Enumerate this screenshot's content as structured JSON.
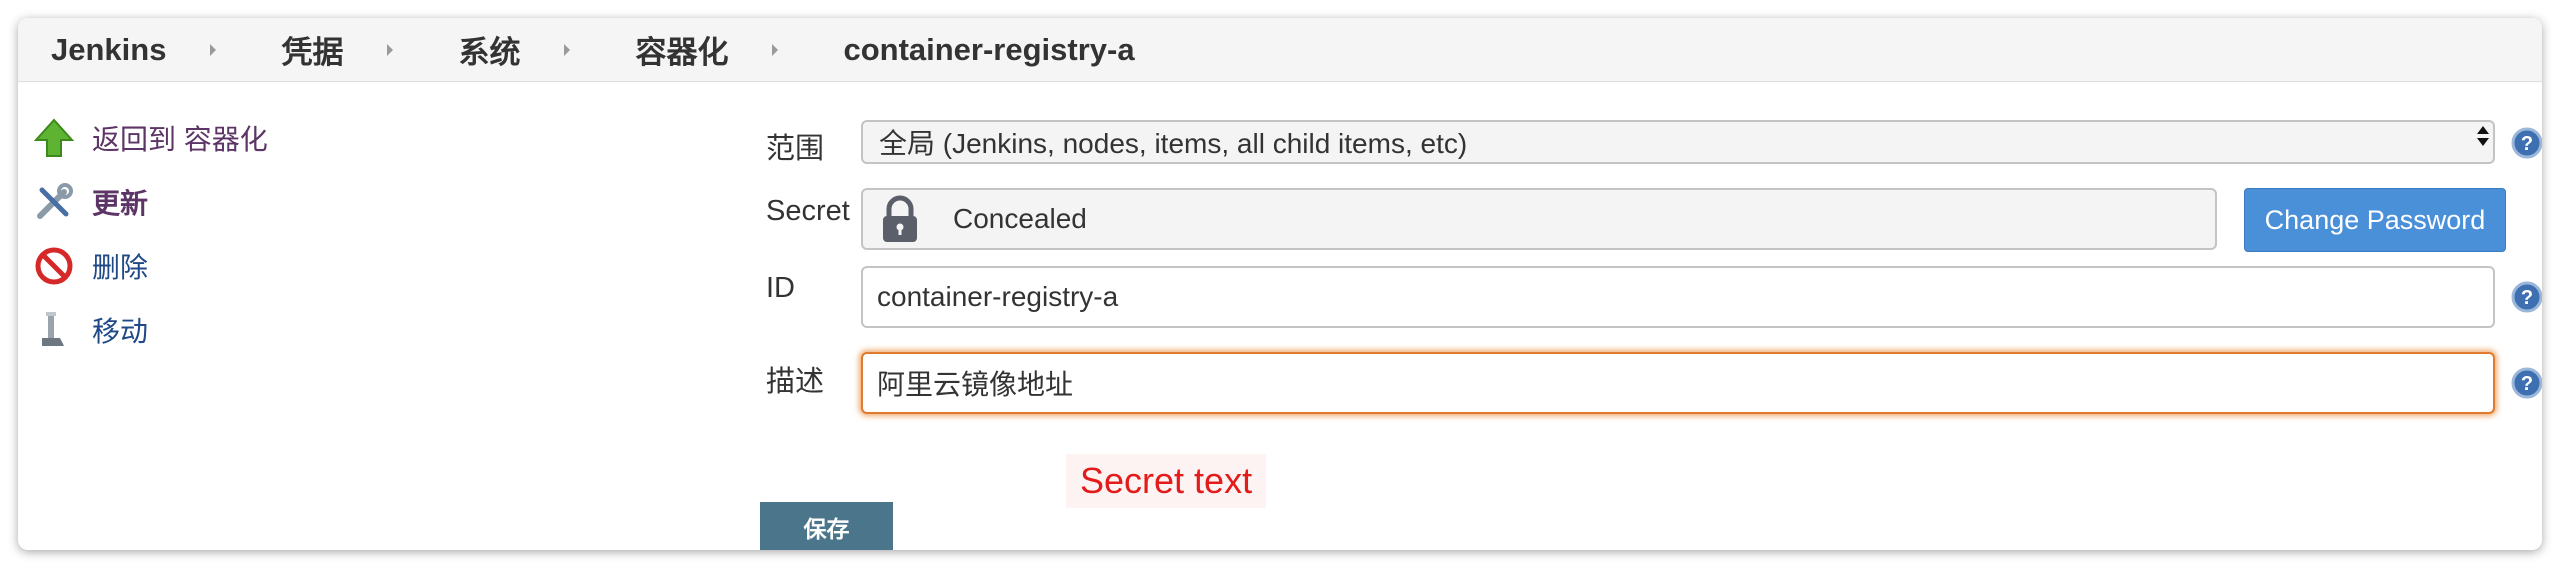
{
  "breadcrumb": [
    "Jenkins",
    "凭据",
    "系统",
    "容器化",
    "container-registry-a"
  ],
  "sidebar": {
    "back_label": "返回到 容器化",
    "update_label": "更新",
    "delete_label": "删除",
    "move_label": "移动"
  },
  "form": {
    "scope_label": "范围",
    "scope_value": "全局 (Jenkins, nodes, items, all child items, etc)",
    "secret_label": "Secret",
    "secret_value": "Concealed",
    "change_password_label": "Change Password",
    "id_label": "ID",
    "id_value": "container-registry-a",
    "description_label": "描述",
    "description_value": "阿里云镜像地址",
    "save_label": "保存"
  },
  "annotation": "Secret text",
  "colors": {
    "primary_button": "#4a90d9",
    "save_button": "#4b758b",
    "annotation_text": "#e31b1b",
    "focus_border": "#e07a2e"
  },
  "icons": {
    "back": "green-up-arrow-icon",
    "update": "wrench-screwdriver-icon",
    "delete": "no-entry-icon",
    "move": "move-icon",
    "secret": "lock-icon",
    "help": "help-icon"
  }
}
